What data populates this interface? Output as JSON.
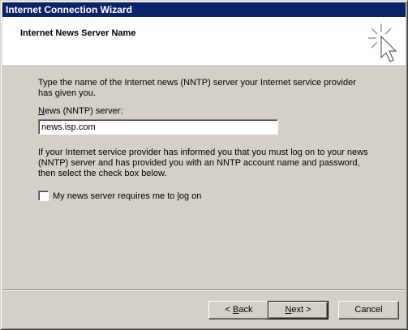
{
  "window": {
    "title": "Internet Connection Wizard"
  },
  "header": {
    "title": "Internet News Server Name",
    "art_icon": "wizard-sparkle-cursor-icon"
  },
  "body": {
    "intro": "Type the name of the Internet news (NNTP) server your Internet service provider has given you.",
    "server_label_prefix": "",
    "server_label_accel": "N",
    "server_label_rest": "ews (NNTP) server:",
    "server_value": "news.isp.com",
    "logon_info": "If your Internet service provider has informed you that you must log on to your news (NNTP) server and has provided you with an NNTP account name and password, then select the check box below.",
    "checkbox_prefix": "My news server requires me to ",
    "checkbox_accel": "l",
    "checkbox_rest": "og on",
    "checkbox_checked": false
  },
  "buttons": {
    "back_prefix": "< ",
    "back_accel": "B",
    "back_rest": "ack",
    "next_accel": "N",
    "next_rest": "ext >",
    "cancel": "Cancel"
  },
  "colors": {
    "titlebar": "#0a246a",
    "face": "#d4d0c8",
    "header_bg": "#ffffff"
  }
}
